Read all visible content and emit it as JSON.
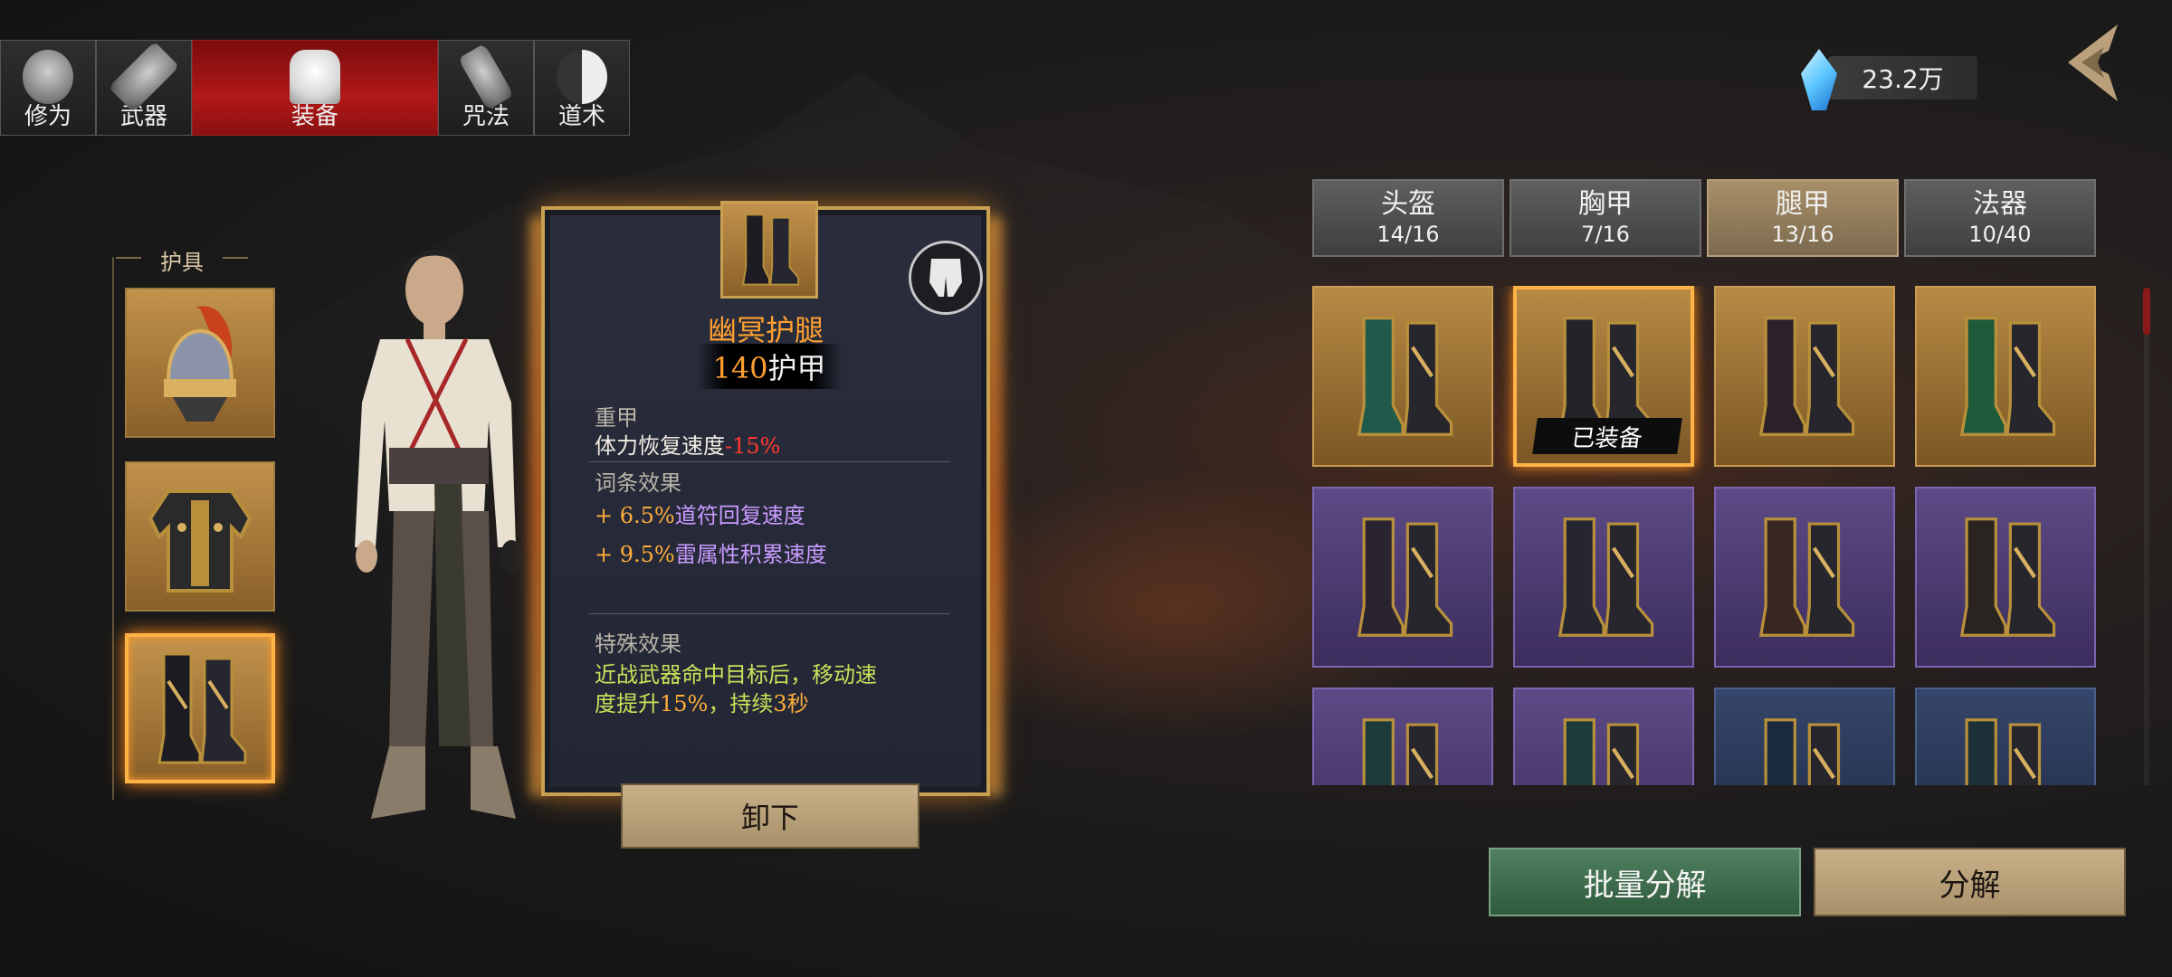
{
  "top_tabs": [
    {
      "label": "修为",
      "icon": "cultivation-icon"
    },
    {
      "label": "武器",
      "icon": "weapon-icon"
    },
    {
      "label": "装备",
      "icon": "robe-icon",
      "active": true
    },
    {
      "label": "咒法",
      "icon": "scroll-icon"
    },
    {
      "label": "道术",
      "icon": "taiji-icon"
    }
  ],
  "currency": {
    "value": "23.2万",
    "icon": "crystal-icon"
  },
  "protector": {
    "label": "护具",
    "slots": [
      "helmet",
      "chest-armor",
      "leg-armor"
    ]
  },
  "item": {
    "name": "幽冥护腿",
    "armor_value": "140",
    "armor_unit": "护甲",
    "type_label": "重甲",
    "penalty_text": "体力恢复速度",
    "penalty_value": "-15%",
    "affix_title": "词条效果",
    "affix1_value": "+ 6.5%",
    "affix1_text": "道符回复速度",
    "affix2_value": "+ 9.5%",
    "affix2_text": "雷属性积累速度",
    "special_title": "特殊效果",
    "special_text_1": "近战武器命中目标后，移动速",
    "special_text_2": "度提升",
    "special_pct": "15%",
    "special_text_3": "，持续",
    "special_dur": "3秒"
  },
  "unequip_label": "卸下",
  "categories": [
    {
      "name": "头盔",
      "count": "14/16"
    },
    {
      "name": "胸甲",
      "count": "7/16"
    },
    {
      "name": "腿甲",
      "count": "13/16",
      "active": true
    },
    {
      "name": "法器",
      "count": "10/40"
    }
  ],
  "inventory": [
    {
      "rarity": "gold",
      "tint": "#1f5a4a"
    },
    {
      "rarity": "gold",
      "tint": "#22242a",
      "equipped": true
    },
    {
      "rarity": "gold",
      "tint": "#2a2228"
    },
    {
      "rarity": "gold",
      "tint": "#1e5a3a"
    },
    {
      "rarity": "purple",
      "tint": "#2a2430"
    },
    {
      "rarity": "purple",
      "tint": "#262630"
    },
    {
      "rarity": "purple",
      "tint": "#3a2620"
    },
    {
      "rarity": "purple",
      "tint": "#2a2420"
    },
    {
      "rarity": "purple",
      "tint": "#1c3a3a"
    },
    {
      "rarity": "purple",
      "tint": "#1c3a38"
    },
    {
      "rarity": "blue",
      "tint": "#1c2a40"
    },
    {
      "rarity": "blue",
      "tint": "#1c3038"
    }
  ],
  "equipped_tag": "已装备",
  "buttons": {
    "bulk_decompose": "批量分解",
    "decompose": "分解"
  },
  "colors": {
    "accent_orange": "#ffa030",
    "tab_active_red": "#b21818",
    "penalty_red": "#ff3a2e",
    "affix_purple": "#c89bff",
    "special_green": "#c6e35a"
  }
}
